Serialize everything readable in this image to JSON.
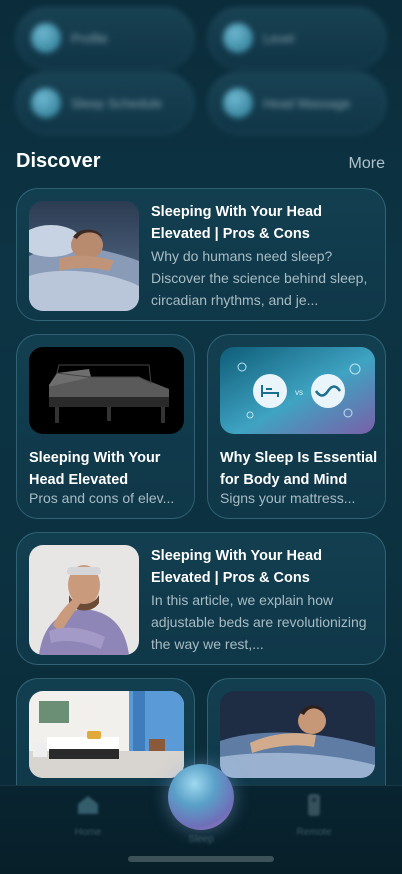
{
  "controls": [
    {
      "label": "Profile"
    },
    {
      "label": "Level"
    },
    {
      "label": "Sleep Schedule"
    },
    {
      "label": "Head Massage"
    }
  ],
  "discover": {
    "title": "Discover",
    "more_label": "More"
  },
  "articles": [
    {
      "title": "Sleeping With Your Head Elevated | Pros & Cons",
      "desc": "Why do humans need sleep? Discover the science behind sleep, circadian rhythms, and je...",
      "image": "man-sleeping-photo"
    },
    {
      "title": "Sleeping With Your Head Elevated",
      "desc": "Pros and cons of elev...",
      "image": "adjustable-bed-photo"
    },
    {
      "title": "Why Sleep Is Essential for Body and Mind",
      "desc": "Signs your mattress...",
      "image": "sleep-icons-graphic",
      "vs_text": "vs"
    },
    {
      "title": "Sleeping With Your Head Elevated | Pros & Cons",
      "desc": "In this article, we explain how adjustable beds are revolutionizing the way we rest,...",
      "image": "tired-man-photo"
    },
    {
      "image": "bedroom-photo"
    },
    {
      "image": "man-sleeping-photo-2"
    }
  ],
  "nav": {
    "home_label": "Home",
    "assistant_label": "Sleep",
    "remote_label": "Remote"
  },
  "colors": {
    "background": "#0c3241",
    "card": "#123f50",
    "accent_orb": "#6e6fb8"
  }
}
